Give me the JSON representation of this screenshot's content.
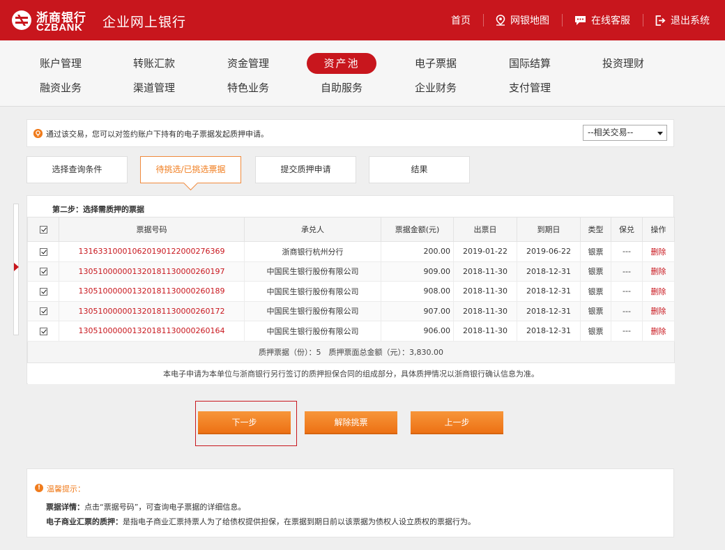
{
  "header": {
    "logo_cn": "浙商银行",
    "logo_en": "CZBANK",
    "title": "企业网上银行",
    "nav": [
      {
        "label": "首页",
        "icon": ""
      },
      {
        "label": "网银地图",
        "icon": "map-pin-icon"
      },
      {
        "label": "在线客服",
        "icon": "chat-icon"
      },
      {
        "label": "退出系统",
        "icon": "logout-icon"
      }
    ]
  },
  "main_nav": {
    "row1": [
      "账户管理",
      "转账汇款",
      "资金管理",
      "资产池",
      "电子票据",
      "国际结算",
      "投资理财"
    ],
    "row2": [
      "融资业务",
      "渠道管理",
      "特色业务",
      "自助服务",
      "企业财务",
      "支付管理"
    ],
    "active": "资产池"
  },
  "info": {
    "text": "通过该交易，您可以对签约账户下持有的电子票据发起质押申请。",
    "related_select": "--相关交易--"
  },
  "steps": [
    "选择查询条件",
    "待挑选/已挑选票据",
    "提交质押申请",
    "结果"
  ],
  "step_active": 1,
  "card": {
    "step_title": "第二步：选择需质押的票据",
    "columns": [
      "票据号码",
      "承兑人",
      "票据金额(元)",
      "出票日",
      "到期日",
      "类型",
      "保兑",
      "操作"
    ],
    "rows": [
      {
        "no": "131633100010620190122000276369",
        "acceptor": "浙商银行杭州分行",
        "amount": "200.00",
        "issue": "2019-01-22",
        "due": "2019-06-22",
        "type": "银票",
        "guar": "---",
        "op": "删除"
      },
      {
        "no": "130510000001320181130000260197",
        "acceptor": "中国民生银行股份有限公司",
        "amount": "909.00",
        "issue": "2018-11-30",
        "due": "2018-12-31",
        "type": "银票",
        "guar": "---",
        "op": "删除"
      },
      {
        "no": "130510000001320181130000260189",
        "acceptor": "中国民生银行股份有限公司",
        "amount": "908.00",
        "issue": "2018-11-30",
        "due": "2018-12-31",
        "type": "银票",
        "guar": "---",
        "op": "删除"
      },
      {
        "no": "130510000001320181130000260172",
        "acceptor": "中国民生银行股份有限公司",
        "amount": "907.00",
        "issue": "2018-11-30",
        "due": "2018-12-31",
        "type": "银票",
        "guar": "---",
        "op": "删除"
      },
      {
        "no": "130510000001320181130000260164",
        "acceptor": "中国民生银行股份有限公司",
        "amount": "906.00",
        "issue": "2018-11-30",
        "due": "2018-12-31",
        "type": "银票",
        "guar": "---",
        "op": "删除"
      }
    ],
    "summary": "质押票据（份）：5　质押票面总金额（元）：3,830.00",
    "note": "本电子申请为本单位与浙商银行另行签订的质押担保合同的组成部分，具体质押情况以浙商银行确认信息为准。"
  },
  "buttons": {
    "next": "下一步",
    "release": "解除挑票",
    "prev": "上一步"
  },
  "tips": {
    "icon": "!",
    "title": "温馨提示：",
    "line1_bold": "票据详情：",
    "line1_text": "点击“票据号码”，可查询电子票据的详细信息。",
    "line2_bold": "电子商业汇票的质押：",
    "line2_text": "是指电子商业汇票持票人为了给债权提供担保，在票据到期日前以该票据为债权人设立质权的票据行为。"
  },
  "colors": {
    "brand_red": "#c8161d",
    "accent_orange": "#f07c1d"
  }
}
